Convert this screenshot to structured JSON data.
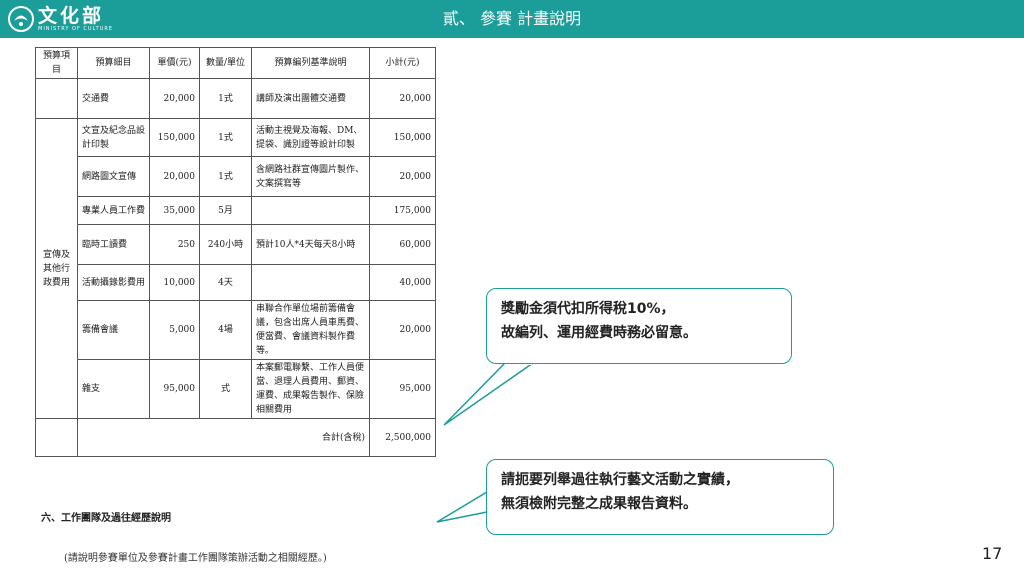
{
  "header": {
    "logo_text": "文化部",
    "logo_subtext": "MINISTRY OF CULTURE",
    "title": "貳、 參賽 計畫說明"
  },
  "table": {
    "headers": [
      "預算項目",
      "預算細目",
      "單價(元)",
      "數量/單位",
      "預算編列基準說明",
      "小計(元)"
    ],
    "rows": [
      {
        "item": "交通費",
        "price": "20,000",
        "qty": "1式",
        "basis": "講師及演出團體交通費",
        "subtotal": "20,000"
      },
      {
        "item": "文宣及紀念品設計印製",
        "price": "150,000",
        "qty": "1式",
        "basis": "活動主視覺及海報、DM、提袋、識別證等設計印製",
        "subtotal": "150,000"
      },
      {
        "item": "網路圖文宣傳",
        "price": "20,000",
        "qty": "1式",
        "basis": "含網路社群宣傳圖片製作、文案撰寫等",
        "subtotal": "20,000"
      },
      {
        "item": "專業人員工作費",
        "price": "35,000",
        "qty": "5月",
        "basis": "",
        "subtotal": "175,000"
      },
      {
        "item": "臨時工讀費",
        "price": "250",
        "qty": "240小時",
        "basis": "預計10人*4天每天8小時",
        "subtotal": "60,000"
      },
      {
        "item": "活動攝錄影費用",
        "price": "10,000",
        "qty": "4天",
        "basis": "",
        "subtotal": "40,000"
      },
      {
        "item": "籌備會議",
        "price": "5,000",
        "qty": "4場",
        "basis": "串聯合作單位場前籌備會議，包含出席人員車馬費、便當費、會議資料製作費等。",
        "subtotal": "20,000"
      },
      {
        "item": "雜支",
        "price": "95,000",
        "qty": "式",
        "basis": "本案郵電聯繫、工作人員便當、退理人員費用、郵資、運費、成果報告製作、保險相關費用",
        "subtotal": "95,000"
      }
    ],
    "group_label": "宣傳及其他行政費用",
    "total_label": "合計(含稅)",
    "total_value": "2,500,000"
  },
  "section": {
    "heading": "六、工作團隊及過往經歷說明",
    "note": "(請說明參賽單位及參賽計畫工作團隊策辦活動之相關經歷。)"
  },
  "callouts": [
    {
      "line1": "獎勵金須代扣所得稅10%，",
      "line2": "故編列、運用經費時務必留意。"
    },
    {
      "line1": "請扼要列舉過往執行藝文活動之實績，",
      "line2": "無須檢附完整之成果報告資料。"
    }
  ],
  "page_number": "17",
  "colors": {
    "accent": "#1b9e9a"
  }
}
